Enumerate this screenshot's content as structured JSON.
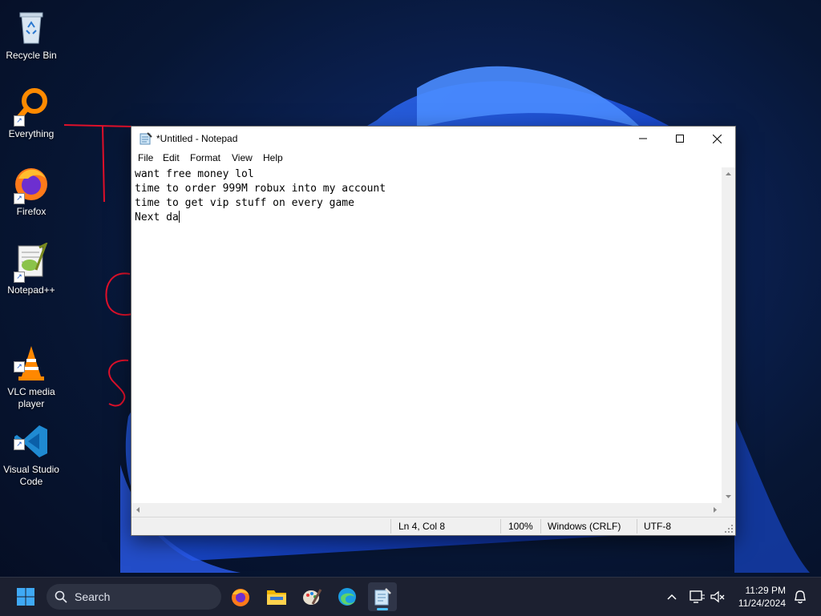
{
  "desktop": {
    "icons": [
      {
        "label": "Recycle Bin"
      },
      {
        "label": "Everything"
      },
      {
        "label": "Firefox"
      },
      {
        "label": "Notepad++"
      },
      {
        "label": "VLC media\nplayer"
      },
      {
        "label": "Visual Studio\nCode"
      }
    ]
  },
  "notepad": {
    "title": "*Untitled - Notepad",
    "menu": [
      "File",
      "Edit",
      "Format",
      "View",
      "Help"
    ],
    "lines": [
      "want free money lol",
      "time to order 999M robux into my account",
      "time to get vip stuff on every game",
      "Next da"
    ],
    "status": {
      "position": "Ln 4, Col 8",
      "zoom": "100%",
      "line_endings": "Windows (CRLF)",
      "encoding": "UTF-8"
    }
  },
  "taskbar": {
    "search_label": "Search",
    "time": "11:29 PM",
    "date": "11/24/2024"
  },
  "colors": {
    "taskbar_bg": "#1c2030",
    "window_bg": "#ffffff",
    "accent_blue": "#1f6fff",
    "annotation_red": "#e0102a"
  }
}
